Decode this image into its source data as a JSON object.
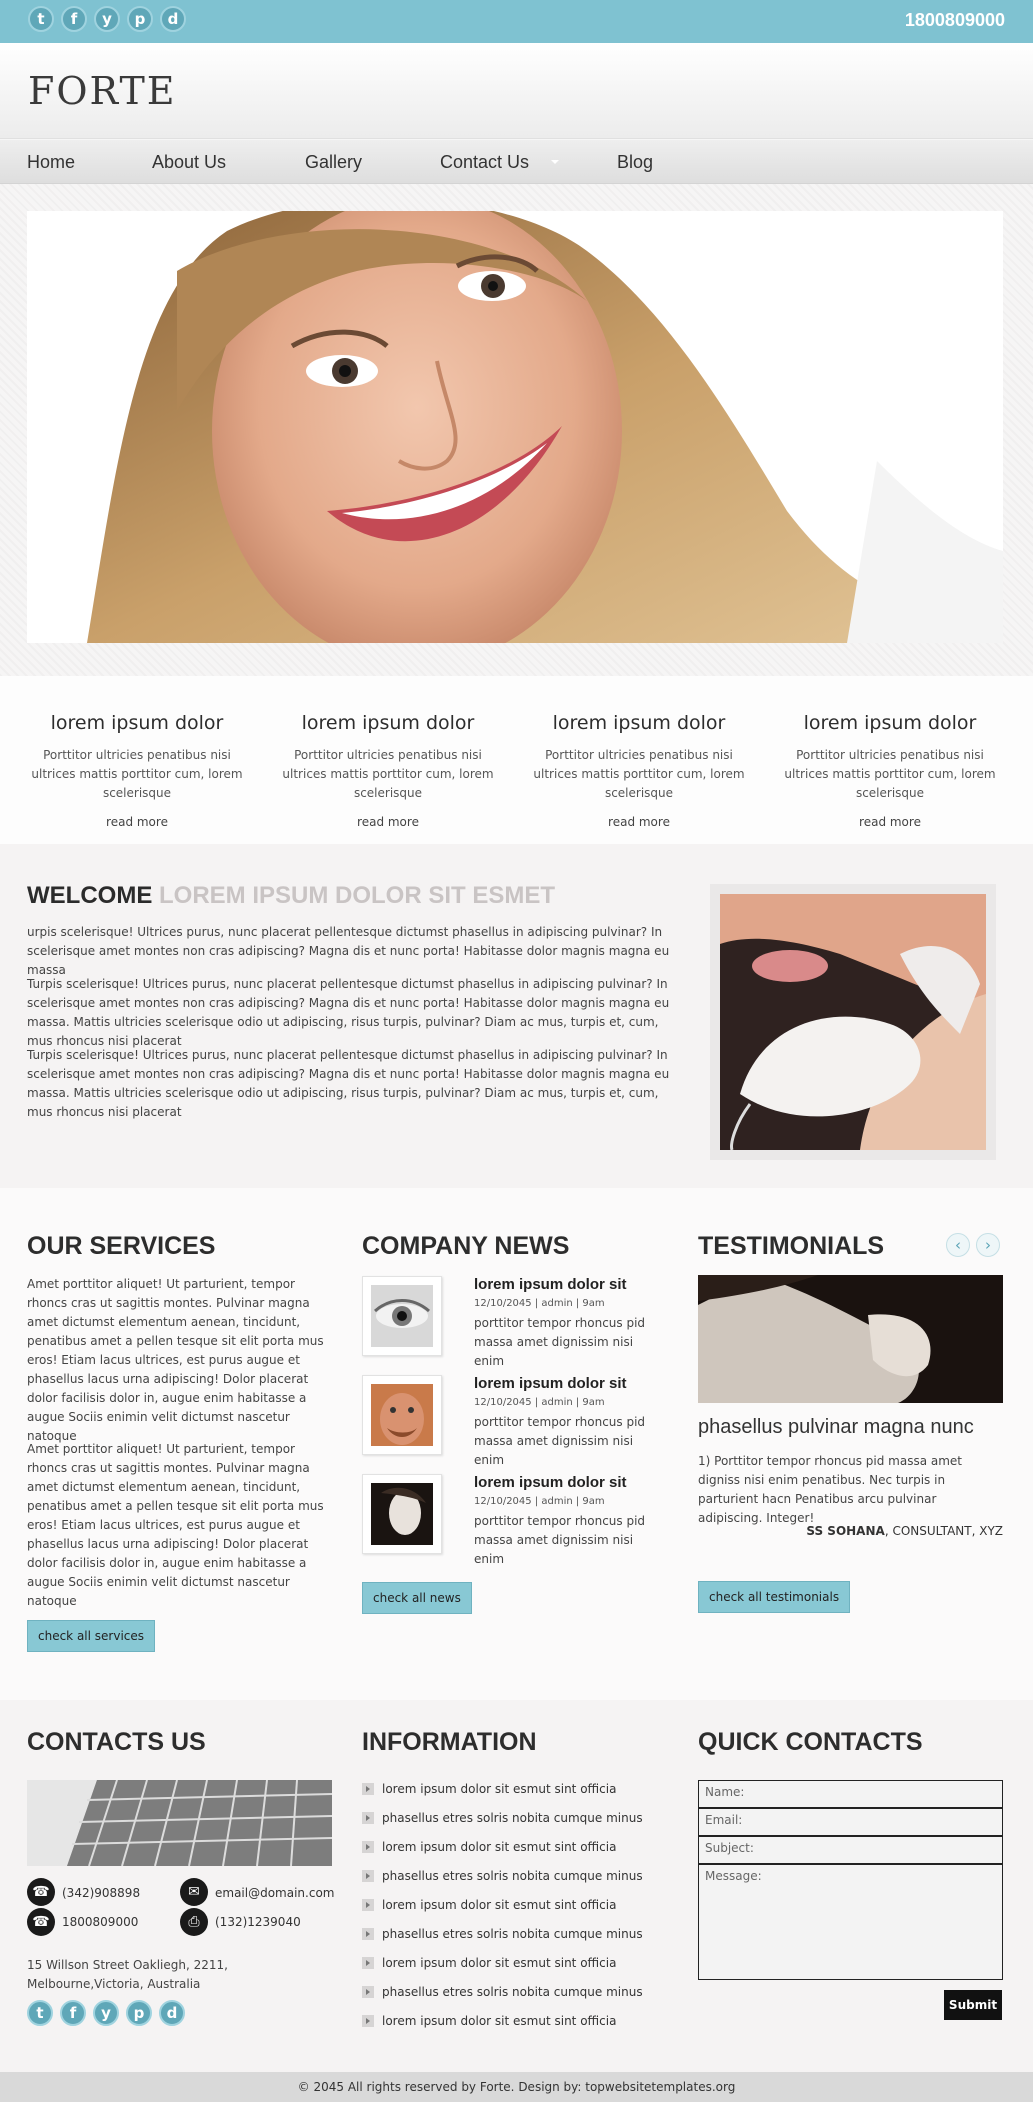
{
  "topbar": {
    "social": [
      "t",
      "f",
      "y",
      "p",
      "d"
    ],
    "phone": "1800809000"
  },
  "brand": {
    "logo": "FORTE"
  },
  "nav": [
    "Home",
    "About Us",
    "Gallery",
    "Contact Us",
    "Blog"
  ],
  "features": [
    {
      "title": "lorem ipsum dolor",
      "text": "Porttitor ultricies penatibus nisi ultrices mattis porttitor cum, lorem scelerisque",
      "link": "read more"
    },
    {
      "title": "lorem ipsum dolor",
      "text": "Porttitor ultricies penatibus nisi ultrices mattis porttitor cum, lorem scelerisque",
      "link": "read more"
    },
    {
      "title": "lorem ipsum dolor",
      "text": "Porttitor ultricies penatibus nisi ultrices mattis porttitor cum, lorem scelerisque",
      "link": "read more"
    },
    {
      "title": "lorem ipsum dolor",
      "text": "Porttitor ultricies penatibus nisi ultrices mattis porttitor cum, lorem scelerisque",
      "link": "read more"
    }
  ],
  "welcome": {
    "title_dark": "WELCOME",
    "title_light": "LOREM IPSUM DOLOR SIT ESMET",
    "paragraphs": [
      "urpis scelerisque! Ultrices purus, nunc placerat pellentesque dictumst phasellus in adipiscing pulvinar? In scelerisque amet montes non cras adipiscing? Magna dis et nunc porta! Habitasse dolor magnis magna eu massa",
      "Turpis scelerisque! Ultrices purus, nunc placerat pellentesque dictumst phasellus in adipiscing pulvinar? In scelerisque amet montes non cras adipiscing? Magna dis et nunc porta! Habitasse dolor magnis magna eu massa. Mattis ultricies scelerisque odio ut adipiscing, risus turpis, pulvinar? Diam ac mus, turpis et, cum, mus rhoncus nisi placerat",
      "Turpis scelerisque! Ultrices purus, nunc placerat pellentesque dictumst phasellus in adipiscing pulvinar? In scelerisque amet montes non cras adipiscing? Magna dis et nunc porta! Habitasse dolor magnis magna eu massa. Mattis ultricies scelerisque odio ut adipiscing, risus turpis, pulvinar? Diam ac mus, turpis et, cum, mus rhoncus nisi placerat"
    ]
  },
  "services": {
    "title": "OUR SERVICES",
    "paragraphs": [
      "Amet porttitor aliquet! Ut parturient, tempor rhoncs cras ut sagittis montes. Pulvinar magna amet dictumst elementum aenean, tincidunt, penatibus amet a pellen tesque sit elit porta mus eros! Etiam lacus ultrices, est purus augue et phasellus lacus urna adipiscing! Dolor placerat dolor facilisis dolor in, augue enim habitasse a augue Sociis enimin velit dictumst nascetur natoque",
      "Amet porttitor aliquet! Ut parturient, tempor rhoncs cras ut sagittis montes. Pulvinar magna amet dictumst elementum aenean, tincidunt, penatibus amet a pellen tesque sit elit porta mus eros! Etiam lacus ultrices, est purus augue et phasellus lacus urna adipiscing! Dolor placerat dolor facilisis dolor in, augue enim habitasse a augue Sociis enimin velit dictumst nascetur natoque"
    ],
    "button": "check all services"
  },
  "news": {
    "title": "COMPANY NEWS",
    "items": [
      {
        "title": "lorem ipsum dolor sit",
        "meta": "12/10/2045 | admin | 9am",
        "text": "porttitor tempor rhoncus pid massa amet dignissim nisi enim"
      },
      {
        "title": "lorem ipsum dolor sit",
        "meta": "12/10/2045 | admin | 9am",
        "text": "porttitor tempor rhoncus pid massa amet dignissim nisi enim"
      },
      {
        "title": "lorem ipsum dolor sit",
        "meta": "12/10/2045 | admin | 9am",
        "text": "porttitor tempor rhoncus pid massa amet dignissim nisi enim"
      }
    ],
    "button": "check all news"
  },
  "testimonials": {
    "title": "TESTIMONIALS",
    "heading": "phasellus pulvinar magna nunc",
    "text": "1) Porttitor tempor rhoncus pid massa amet digniss nisi enim penatibus. Nec turpis in parturient hacn Penatibus arcu pulvinar adipiscing. Integer!",
    "author": "SS SOHANA",
    "role": ", CONSULTANT, XYZ",
    "button": "check all testimonials"
  },
  "contacts": {
    "title": "CONTACTS US",
    "phone1": "(342)908898",
    "email": "email@domain.com",
    "phone2": "1800809000",
    "fax": "(132)1239040",
    "address": "15 Willson Street Oakliegh, 2211, Melbourne,Victoria, Australia",
    "social": [
      "t",
      "f",
      "y",
      "p",
      "d"
    ]
  },
  "information": {
    "title": "INFORMATION",
    "items": [
      "lorem ipsum dolor sit esmut sint officia",
      "phasellus etres solris nobita cumque minus",
      "lorem ipsum dolor sit esmut sint officia",
      "phasellus etres solris nobita cumque minus",
      "lorem ipsum dolor sit esmut sint officia",
      "phasellus etres solris nobita cumque minus",
      "lorem ipsum dolor sit esmut sint officia",
      "phasellus etres solris nobita cumque minus",
      "lorem ipsum dolor sit esmut sint officia"
    ]
  },
  "quick_contacts": {
    "title": "QUICK CONTACTS",
    "name": "Name:",
    "email": "Email:",
    "subject": "Subject:",
    "message": "Message:",
    "submit": "Submit"
  },
  "footer": {
    "text": "© 2045 All rights reserved by Forte. Design by: topwebsitetemplates.org"
  },
  "colors": {
    "accent": "#7fc2d1",
    "button": "#88c8d4",
    "dark": "#2d2d2d"
  }
}
